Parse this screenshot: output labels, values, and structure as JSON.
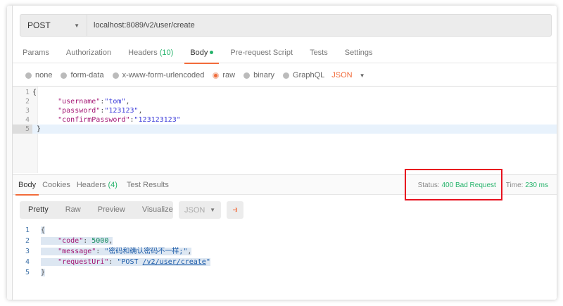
{
  "request": {
    "method": "POST",
    "url": "localhost:8089/v2/user/create"
  },
  "tabs": [
    {
      "label": "Params"
    },
    {
      "label": "Authorization"
    },
    {
      "label": "Headers",
      "count": "(10)"
    },
    {
      "label": "Body"
    },
    {
      "label": "Pre-request Script"
    },
    {
      "label": "Tests"
    },
    {
      "label": "Settings"
    }
  ],
  "body_options": {
    "items": [
      "none",
      "form-data",
      "x-www-form-urlencoded",
      "raw",
      "binary",
      "GraphQL"
    ],
    "selected": "raw",
    "format": "JSON"
  },
  "editor": {
    "line_numbers": [
      "1",
      "2",
      "3",
      "4",
      "5"
    ],
    "open": "{",
    "close": "}",
    "fields": [
      {
        "key": "\"username\"",
        "value": "\"tom\"",
        "trail": ","
      },
      {
        "key": "\"password\"",
        "value": "\"123123\"",
        "trail": ","
      },
      {
        "key": "\"confirmPassword\"",
        "value": "\"123123123\"",
        "trail": ""
      }
    ]
  },
  "response": {
    "tabs": [
      {
        "label": "Body"
      },
      {
        "label": "Cookies"
      },
      {
        "label": "Headers",
        "count": "(4)"
      },
      {
        "label": "Test Results"
      }
    ],
    "status_label": "Status:",
    "status": "400 Bad Request",
    "time_label": "Time:",
    "time": "230 ms",
    "views": [
      "Pretty",
      "Raw",
      "Preview",
      "Visualize"
    ],
    "format": "JSON",
    "line_numbers": [
      "1",
      "2",
      "3",
      "4",
      "5"
    ],
    "code_key": "\"code\"",
    "code_value": "5000",
    "message_key": "\"message\"",
    "message_value": "\"密码和确认密码不一样;\"",
    "uri_key": "\"requestUri\"",
    "uri_prefix": "\"POST ",
    "uri_link": "/v2/user/create",
    "uri_suffix": "\"",
    "open": "{",
    "close": "}"
  },
  "colors": {
    "accent": "#f26b3a",
    "success": "#26b36b",
    "highlight_box": "#e8121f"
  }
}
